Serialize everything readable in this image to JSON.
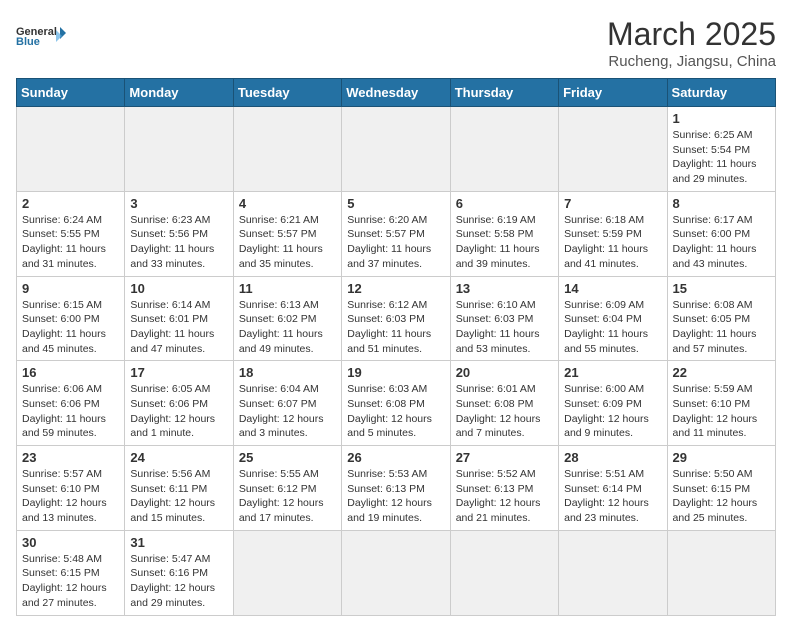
{
  "header": {
    "logo_general": "General",
    "logo_blue": "Blue",
    "month_year": "March 2025",
    "location": "Rucheng, Jiangsu, China"
  },
  "days_of_week": [
    "Sunday",
    "Monday",
    "Tuesday",
    "Wednesday",
    "Thursday",
    "Friday",
    "Saturday"
  ],
  "weeks": [
    [
      {
        "day": "",
        "empty": true
      },
      {
        "day": "",
        "empty": true
      },
      {
        "day": "",
        "empty": true
      },
      {
        "day": "",
        "empty": true
      },
      {
        "day": "",
        "empty": true
      },
      {
        "day": "",
        "empty": true
      },
      {
        "day": "1",
        "sunrise": "6:25 AM",
        "sunset": "5:54 PM",
        "daylight": "11 hours and 29 minutes."
      }
    ],
    [
      {
        "day": "2",
        "sunrise": "6:24 AM",
        "sunset": "5:55 PM",
        "daylight": "11 hours and 31 minutes."
      },
      {
        "day": "3",
        "sunrise": "6:23 AM",
        "sunset": "5:56 PM",
        "daylight": "11 hours and 33 minutes."
      },
      {
        "day": "4",
        "sunrise": "6:21 AM",
        "sunset": "5:57 PM",
        "daylight": "11 hours and 35 minutes."
      },
      {
        "day": "5",
        "sunrise": "6:20 AM",
        "sunset": "5:57 PM",
        "daylight": "11 hours and 37 minutes."
      },
      {
        "day": "6",
        "sunrise": "6:19 AM",
        "sunset": "5:58 PM",
        "daylight": "11 hours and 39 minutes."
      },
      {
        "day": "7",
        "sunrise": "6:18 AM",
        "sunset": "5:59 PM",
        "daylight": "11 hours and 41 minutes."
      },
      {
        "day": "8",
        "sunrise": "6:17 AM",
        "sunset": "6:00 PM",
        "daylight": "11 hours and 43 minutes."
      }
    ],
    [
      {
        "day": "9",
        "sunrise": "6:15 AM",
        "sunset": "6:00 PM",
        "daylight": "11 hours and 45 minutes."
      },
      {
        "day": "10",
        "sunrise": "6:14 AM",
        "sunset": "6:01 PM",
        "daylight": "11 hours and 47 minutes."
      },
      {
        "day": "11",
        "sunrise": "6:13 AM",
        "sunset": "6:02 PM",
        "daylight": "11 hours and 49 minutes."
      },
      {
        "day": "12",
        "sunrise": "6:12 AM",
        "sunset": "6:03 PM",
        "daylight": "11 hours and 51 minutes."
      },
      {
        "day": "13",
        "sunrise": "6:10 AM",
        "sunset": "6:03 PM",
        "daylight": "11 hours and 53 minutes."
      },
      {
        "day": "14",
        "sunrise": "6:09 AM",
        "sunset": "6:04 PM",
        "daylight": "11 hours and 55 minutes."
      },
      {
        "day": "15",
        "sunrise": "6:08 AM",
        "sunset": "6:05 PM",
        "daylight": "11 hours and 57 minutes."
      }
    ],
    [
      {
        "day": "16",
        "sunrise": "6:06 AM",
        "sunset": "6:06 PM",
        "daylight": "11 hours and 59 minutes."
      },
      {
        "day": "17",
        "sunrise": "6:05 AM",
        "sunset": "6:06 PM",
        "daylight": "12 hours and 1 minute."
      },
      {
        "day": "18",
        "sunrise": "6:04 AM",
        "sunset": "6:07 PM",
        "daylight": "12 hours and 3 minutes."
      },
      {
        "day": "19",
        "sunrise": "6:03 AM",
        "sunset": "6:08 PM",
        "daylight": "12 hours and 5 minutes."
      },
      {
        "day": "20",
        "sunrise": "6:01 AM",
        "sunset": "6:08 PM",
        "daylight": "12 hours and 7 minutes."
      },
      {
        "day": "21",
        "sunrise": "6:00 AM",
        "sunset": "6:09 PM",
        "daylight": "12 hours and 9 minutes."
      },
      {
        "day": "22",
        "sunrise": "5:59 AM",
        "sunset": "6:10 PM",
        "daylight": "12 hours and 11 minutes."
      }
    ],
    [
      {
        "day": "23",
        "sunrise": "5:57 AM",
        "sunset": "6:10 PM",
        "daylight": "12 hours and 13 minutes."
      },
      {
        "day": "24",
        "sunrise": "5:56 AM",
        "sunset": "6:11 PM",
        "daylight": "12 hours and 15 minutes."
      },
      {
        "day": "25",
        "sunrise": "5:55 AM",
        "sunset": "6:12 PM",
        "daylight": "12 hours and 17 minutes."
      },
      {
        "day": "26",
        "sunrise": "5:53 AM",
        "sunset": "6:13 PM",
        "daylight": "12 hours and 19 minutes."
      },
      {
        "day": "27",
        "sunrise": "5:52 AM",
        "sunset": "6:13 PM",
        "daylight": "12 hours and 21 minutes."
      },
      {
        "day": "28",
        "sunrise": "5:51 AM",
        "sunset": "6:14 PM",
        "daylight": "12 hours and 23 minutes."
      },
      {
        "day": "29",
        "sunrise": "5:50 AM",
        "sunset": "6:15 PM",
        "daylight": "12 hours and 25 minutes."
      }
    ],
    [
      {
        "day": "30",
        "sunrise": "5:48 AM",
        "sunset": "6:15 PM",
        "daylight": "12 hours and 27 minutes."
      },
      {
        "day": "31",
        "sunrise": "5:47 AM",
        "sunset": "6:16 PM",
        "daylight": "12 hours and 29 minutes."
      },
      {
        "day": "",
        "empty": true
      },
      {
        "day": "",
        "empty": true
      },
      {
        "day": "",
        "empty": true
      },
      {
        "day": "",
        "empty": true
      },
      {
        "day": "",
        "empty": true
      }
    ]
  ],
  "labels": {
    "sunrise": "Sunrise:",
    "sunset": "Sunset:",
    "daylight": "Daylight:"
  }
}
